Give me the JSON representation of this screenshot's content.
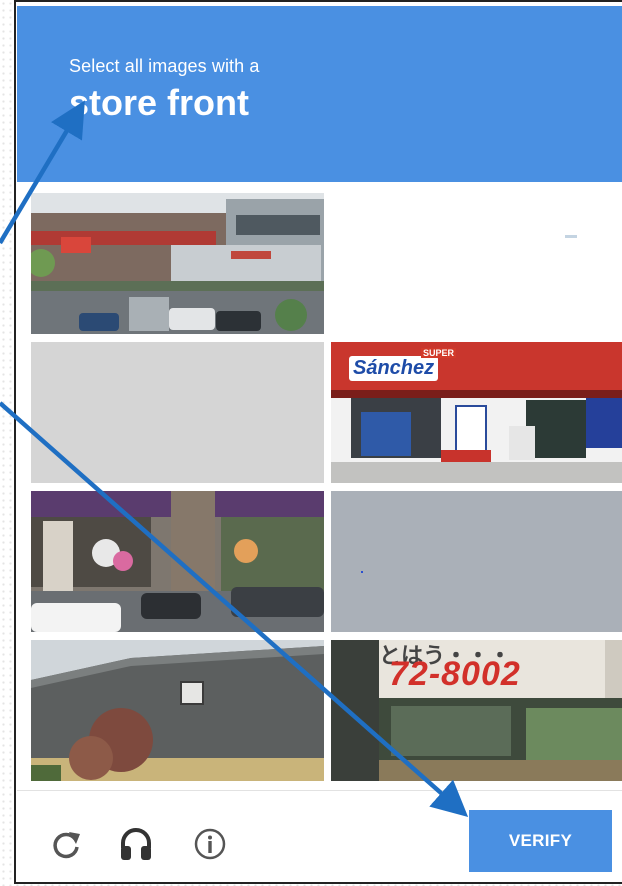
{
  "challenge": {
    "instruction": "Select all images with a",
    "target": "store front"
  },
  "tiles": [
    {
      "description": "commercial building with shops and parked cars",
      "sign": ""
    },
    {
      "description": "blank white image",
      "sign": ""
    },
    {
      "description": "plain gray image",
      "sign": ""
    },
    {
      "description": "Sanchez supermarket storefront",
      "sign": "Sánchez",
      "sign_super": "SUPER"
    },
    {
      "description": "street with shop front, tree and cars",
      "sign": ""
    },
    {
      "description": "plain gray road surface",
      "sign": ""
    },
    {
      "description": "house roof with tree",
      "sign": ""
    },
    {
      "description": "shop sign with phone number",
      "sign": "72-8002",
      "sign_top": "とはう・・・"
    }
  ],
  "footer": {
    "reload_icon": "reload-icon",
    "audio_icon": "headphones-icon",
    "info_icon": "info-icon",
    "verify_label": "VERIFY"
  },
  "colors": {
    "accent": "#4a90e2",
    "arrow": "#1f6fc3"
  }
}
